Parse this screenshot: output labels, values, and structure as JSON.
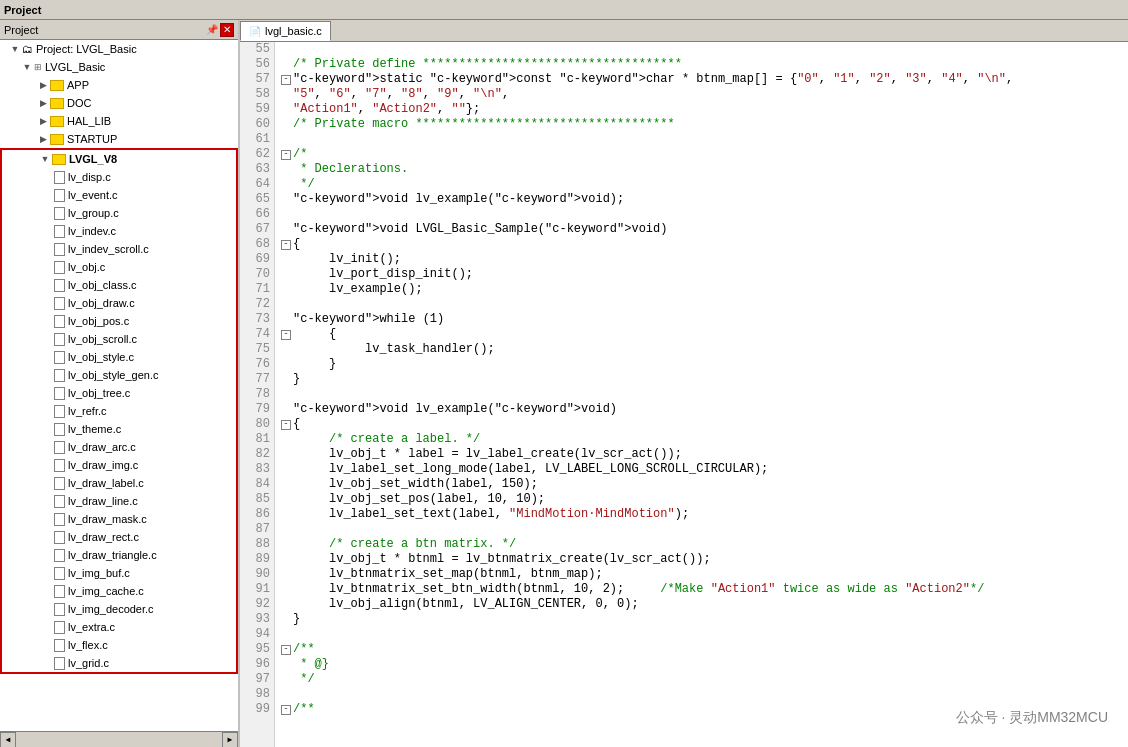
{
  "panel": {
    "title": "Project",
    "tab_label": "lvgl_basic.c"
  },
  "tree": {
    "root_label": "Project: LVGL_Basic",
    "items": [
      {
        "id": "lvgl_basic",
        "label": "LVGL_Basic",
        "indent": 1,
        "type": "project",
        "expanded": true
      },
      {
        "id": "app",
        "label": "APP",
        "indent": 2,
        "type": "folder",
        "expanded": false
      },
      {
        "id": "doc",
        "label": "DOC",
        "indent": 2,
        "type": "folder",
        "expanded": false
      },
      {
        "id": "hal_lib",
        "label": "HAL_LIB",
        "indent": 2,
        "type": "folder",
        "expanded": false
      },
      {
        "id": "startup",
        "label": "STARTUP",
        "indent": 2,
        "type": "folder",
        "expanded": false
      },
      {
        "id": "lvgl_v8",
        "label": "LVGL_V8",
        "indent": 2,
        "type": "folder",
        "expanded": true,
        "highlighted": true
      },
      {
        "id": "lv_disp",
        "label": "lv_disp.c",
        "indent": 3,
        "type": "file"
      },
      {
        "id": "lv_event",
        "label": "lv_event.c",
        "indent": 3,
        "type": "file"
      },
      {
        "id": "lv_group",
        "label": "lv_group.c",
        "indent": 3,
        "type": "file"
      },
      {
        "id": "lv_indev",
        "label": "lv_indev.c",
        "indent": 3,
        "type": "file"
      },
      {
        "id": "lv_indev_scroll",
        "label": "lv_indev_scroll.c",
        "indent": 3,
        "type": "file"
      },
      {
        "id": "lv_obj",
        "label": "lv_obj.c",
        "indent": 3,
        "type": "file"
      },
      {
        "id": "lv_obj_class",
        "label": "lv_obj_class.c",
        "indent": 3,
        "type": "file"
      },
      {
        "id": "lv_obj_draw",
        "label": "lv_obj_draw.c",
        "indent": 3,
        "type": "file"
      },
      {
        "id": "lv_obj_pos",
        "label": "lv_obj_pos.c",
        "indent": 3,
        "type": "file"
      },
      {
        "id": "lv_obj_scroll",
        "label": "lv_obj_scroll.c",
        "indent": 3,
        "type": "file"
      },
      {
        "id": "lv_obj_style",
        "label": "lv_obj_style.c",
        "indent": 3,
        "type": "file"
      },
      {
        "id": "lv_obj_style_gen",
        "label": "lv_obj_style_gen.c",
        "indent": 3,
        "type": "file"
      },
      {
        "id": "lv_obj_tree",
        "label": "lv_obj_tree.c",
        "indent": 3,
        "type": "file"
      },
      {
        "id": "lv_refr",
        "label": "lv_refr.c",
        "indent": 3,
        "type": "file"
      },
      {
        "id": "lv_theme",
        "label": "lv_theme.c",
        "indent": 3,
        "type": "file"
      },
      {
        "id": "lv_draw_arc",
        "label": "lv_draw_arc.c",
        "indent": 3,
        "type": "file"
      },
      {
        "id": "lv_draw_img",
        "label": "lv_draw_img.c",
        "indent": 3,
        "type": "file"
      },
      {
        "id": "lv_draw_label",
        "label": "lv_draw_label.c",
        "indent": 3,
        "type": "file"
      },
      {
        "id": "lv_draw_line",
        "label": "lv_draw_line.c",
        "indent": 3,
        "type": "file"
      },
      {
        "id": "lv_draw_mask",
        "label": "lv_draw_mask.c",
        "indent": 3,
        "type": "file"
      },
      {
        "id": "lv_draw_rect",
        "label": "lv_draw_rect.c",
        "indent": 3,
        "type": "file"
      },
      {
        "id": "lv_draw_triangle",
        "label": "lv_draw_triangle.c",
        "indent": 3,
        "type": "file"
      },
      {
        "id": "lv_img_buf",
        "label": "lv_img_buf.c",
        "indent": 3,
        "type": "file"
      },
      {
        "id": "lv_img_cache",
        "label": "lv_img_cache.c",
        "indent": 3,
        "type": "file"
      },
      {
        "id": "lv_img_decoder",
        "label": "lv_img_decoder.c",
        "indent": 3,
        "type": "file"
      },
      {
        "id": "lv_extra",
        "label": "lv_extra.c",
        "indent": 3,
        "type": "file"
      },
      {
        "id": "lv_flex",
        "label": "lv_flex.c",
        "indent": 3,
        "type": "file"
      },
      {
        "id": "lv_grid",
        "label": "lv_grid.c",
        "indent": 3,
        "type": "file"
      }
    ]
  },
  "code": {
    "lines": [
      {
        "num": 55,
        "content": "",
        "type": "normal"
      },
      {
        "num": 56,
        "content": "/* Private define ************************************",
        "type": "comment"
      },
      {
        "num": 57,
        "content": "static const char * btnm_map[] = {\"0\", \"1\", \"2\", \"3\", \"4\", \"\\n\",",
        "type": "code",
        "expand": "-"
      },
      {
        "num": 58,
        "content": "                                   \"5\", \"6\", \"7\", \"8\", \"9\", \"\\n\",",
        "type": "code"
      },
      {
        "num": 59,
        "content": "                                   \"Action1\", \"Action2\", \"\"};",
        "type": "code"
      },
      {
        "num": 60,
        "content": "/* Private macro ************************************",
        "type": "comment"
      },
      {
        "num": 61,
        "content": "",
        "type": "normal"
      },
      {
        "num": 62,
        "content": "/*",
        "type": "comment",
        "expand": "-"
      },
      {
        "num": 63,
        "content": " * Declerations.",
        "type": "comment"
      },
      {
        "num": 64,
        "content": " */",
        "type": "comment"
      },
      {
        "num": 65,
        "content": "void lv_example(void);",
        "type": "code"
      },
      {
        "num": 66,
        "content": "",
        "type": "normal"
      },
      {
        "num": 67,
        "content": "void LVGL_Basic_Sample(void)",
        "type": "code"
      },
      {
        "num": 68,
        "content": "{",
        "type": "code",
        "expand": "-"
      },
      {
        "num": 69,
        "content": "     lv_init();",
        "type": "code"
      },
      {
        "num": 70,
        "content": "     lv_port_disp_init();",
        "type": "code"
      },
      {
        "num": 71,
        "content": "     lv_example();",
        "type": "code"
      },
      {
        "num": 72,
        "content": "",
        "type": "normal"
      },
      {
        "num": 73,
        "content": "     while (1)",
        "type": "code"
      },
      {
        "num": 74,
        "content": "     {",
        "type": "code",
        "expand": "-"
      },
      {
        "num": 75,
        "content": "          lv_task_handler();",
        "type": "code"
      },
      {
        "num": 76,
        "content": "     }",
        "type": "code"
      },
      {
        "num": 77,
        "content": "}",
        "type": "code"
      },
      {
        "num": 78,
        "content": "",
        "type": "normal"
      },
      {
        "num": 79,
        "content": "void lv_example(void)",
        "type": "code"
      },
      {
        "num": 80,
        "content": "{",
        "type": "code",
        "expand": "-"
      },
      {
        "num": 81,
        "content": "     /* create a label. */",
        "type": "comment"
      },
      {
        "num": 82,
        "content": "     lv_obj_t * label = lv_label_create(lv_scr_act());",
        "type": "code"
      },
      {
        "num": 83,
        "content": "     lv_label_set_long_mode(label, LV_LABEL_LONG_SCROLL_CIRCULAR);",
        "type": "code"
      },
      {
        "num": 84,
        "content": "     lv_obj_set_width(label, 150);",
        "type": "code"
      },
      {
        "num": 85,
        "content": "     lv_obj_set_pos(label, 10, 10);",
        "type": "code"
      },
      {
        "num": 86,
        "content": "     lv_label_set_text(label, \"MindMotion·MindMotion\");",
        "type": "code"
      },
      {
        "num": 87,
        "content": "",
        "type": "normal"
      },
      {
        "num": 88,
        "content": "     /* create a btn matrix. */",
        "type": "comment"
      },
      {
        "num": 89,
        "content": "     lv_obj_t * btnml = lv_btnmatrix_create(lv_scr_act());",
        "type": "code"
      },
      {
        "num": 90,
        "content": "     lv_btnmatrix_set_map(btnml, btnm_map);",
        "type": "code"
      },
      {
        "num": 91,
        "content": "     lv_btnmatrix_set_btn_width(btnml, 10, 2);     /*Make \"Action1\" twice as wide as \"Action2\"*/",
        "type": "code"
      },
      {
        "num": 92,
        "content": "     lv_obj_align(btnml, LV_ALIGN_CENTER, 0, 0);",
        "type": "code"
      },
      {
        "num": 93,
        "content": "}",
        "type": "code"
      },
      {
        "num": 94,
        "content": "",
        "type": "normal"
      },
      {
        "num": 95,
        "content": "/**",
        "type": "comment",
        "expand": "-"
      },
      {
        "num": 96,
        "content": " * @}",
        "type": "comment"
      },
      {
        "num": 97,
        "content": " */",
        "type": "comment"
      },
      {
        "num": 98,
        "content": "",
        "type": "normal"
      },
      {
        "num": 99,
        "content": "/**",
        "type": "comment",
        "expand": "-"
      }
    ]
  },
  "watermark": "公众号 · 灵动MM32MCU"
}
